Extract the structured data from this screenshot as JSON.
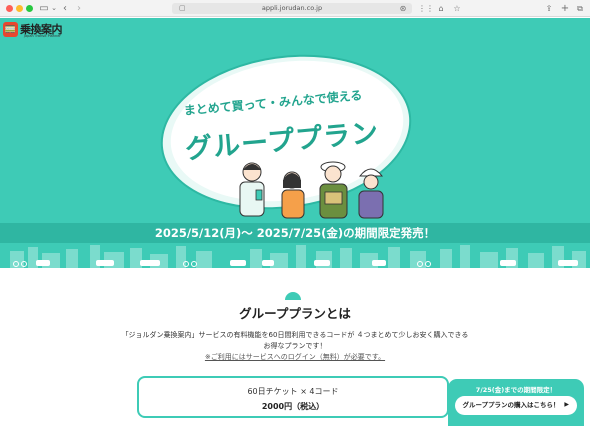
{
  "browser": {
    "url": "appli.jorudan.co.jp",
    "icons": [
      "sidebar-icon",
      "chevron-down-icon",
      "back-icon",
      "forward-icon",
      "shield-icon",
      "translate-icon",
      "extensions-icon",
      "mail-icon",
      "home-icon",
      "star-icon",
      "share-icon",
      "new-tab-icon",
      "tabs-icon"
    ]
  },
  "hero": {
    "logo_text": "乗換案内",
    "logo_sub": "Japan Transit Planner",
    "subtitle": "まとめて買って・みんなで使える",
    "title": "グループプラン",
    "promo": "2025/5/12(月)〜 2025/7/25(金)の期間限定発売！"
  },
  "section": {
    "title": "グループプランとは",
    "desc_line1": "「ジョルダン乗換案内」サービスの有料機能を60日間利用できるコードが ４つまとめて少しお安く購入できる",
    "desc_line2": "お得なプランです！",
    "desc_note": "※ご利用にはサービスへのログイン（無料）が必要です。"
  },
  "ticket": {
    "line1": "60日チケット × 4コード",
    "line2": "2000円（税込）"
  },
  "floating": {
    "note": "7/25(金)までの期間限定！",
    "button": "グループプランの購入はこちら！"
  },
  "colors": {
    "brand": "#3ecbb6",
    "brand_dark": "#22a48e",
    "logo_red": "#e8472f"
  }
}
